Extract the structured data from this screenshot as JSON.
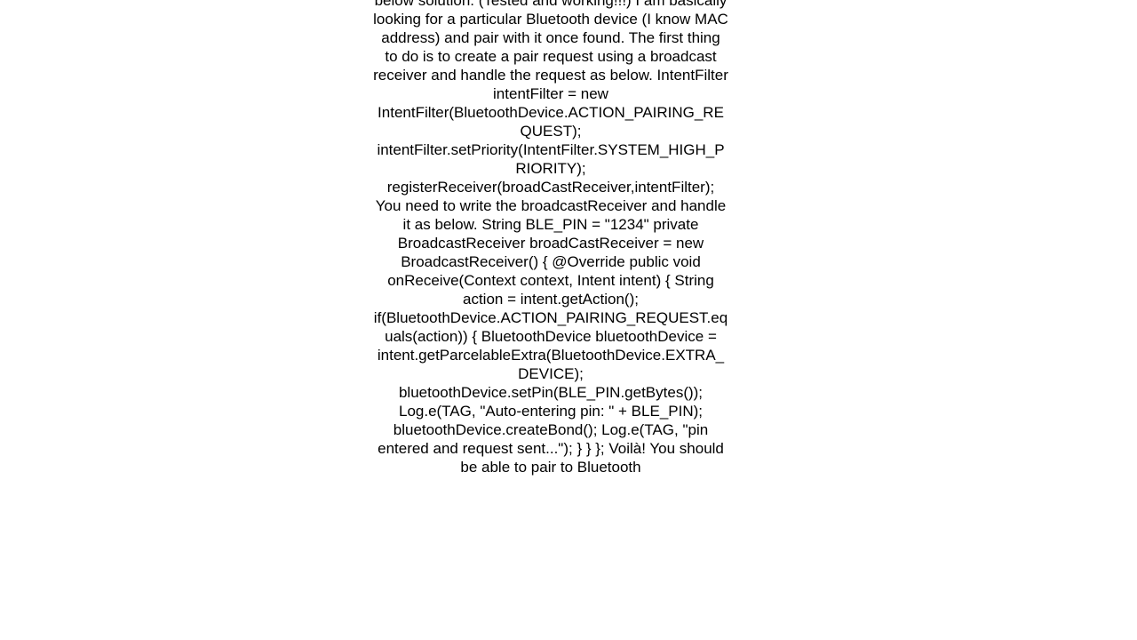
{
  "answer": {
    "body_text": "below solution. (Tested and working!!!) I am basically looking for a particular Bluetooth device (I know MAC address) and pair with it once found. The first thing to do is to create a pair request using a broadcast receiver and handle the request as below. IntentFilter intentFilter = new IntentFilter(BluetoothDevice.ACTION_PAIRING_REQUEST); intentFilter.setPriority(IntentFilter.SYSTEM_HIGH_PRIORITY); registerReceiver(broadCastReceiver,intentFilter);  You need to write the broadcastReceiver and handle it as below. String BLE_PIN = \"1234\" private BroadcastReceiver broadCastReceiver = new BroadcastReceiver() {     @Override     public void onReceive(Context context, Intent intent) {         String action = intent.getAction();         if(BluetoothDevice.ACTION_PAIRING_REQUEST.equals(action))         {             BluetoothDevice bluetoothDevice = intent.getParcelableExtra(BluetoothDevice.EXTRA_DEVICE);             bluetoothDevice.setPin(BLE_PIN.getBytes());             Log.e(TAG, \"Auto-entering pin: \" + BLE_PIN);             bluetoothDevice.createBond();             Log.e(TAG, \"pin entered and request sent...\");         }     } };  Voilà! You should be able to pair to Bluetooth"
  }
}
